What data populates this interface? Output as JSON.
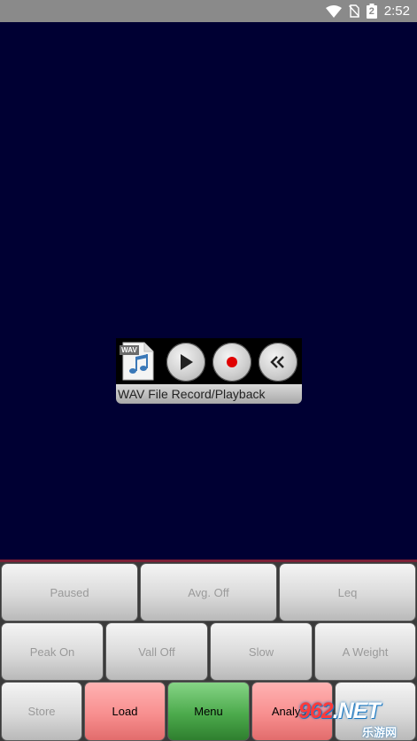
{
  "status_bar": {
    "time": "2:52",
    "battery_text": "2"
  },
  "wav_panel": {
    "label": "WAV File Record/Playback",
    "file_icon_text": "WAV"
  },
  "controls": {
    "row1": [
      "Paused",
      "Avg. Off",
      "Leq"
    ],
    "row2": [
      "Peak On",
      "Vall Off",
      "Slow",
      "A Weight"
    ],
    "row3": [
      "Store",
      "Load",
      "Menu",
      "Analyse",
      ""
    ]
  },
  "watermark": {
    "logo_prefix": "962",
    "logo_suffix": ".NET",
    "subtitle": "乐游网"
  },
  "colors": {
    "display_bg": "#000033",
    "load_btn": "#f88f8f",
    "menu_btn": "#4caa4c",
    "analyse_btn": "#f88f8f",
    "record_dot": "#e00000"
  }
}
